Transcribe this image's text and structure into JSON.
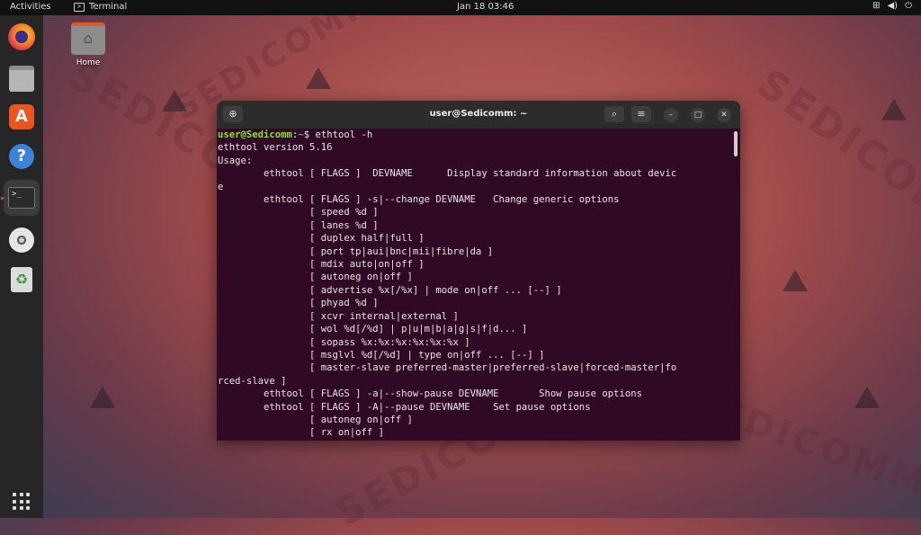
{
  "topbar": {
    "activities": "Activities",
    "app_menu": "Terminal",
    "clock": "Jan 18  03:46",
    "tray_icons": [
      "network-icon",
      "volume-icon",
      "power-icon"
    ]
  },
  "desktop": {
    "home_label": "Home",
    "watermark": "SEDICOMM"
  },
  "dock": {
    "items": [
      "firefox-icon",
      "files-icon",
      "software-icon",
      "help-icon",
      "terminal-icon",
      "disc-icon",
      "trash-icon"
    ],
    "active": "terminal-icon",
    "show_apps": "show-apps-icon"
  },
  "terminal": {
    "title": "user@Sedicomm: ~",
    "prompt_user": "user@Sedicomm",
    "prompt_sep": ":",
    "prompt_path": "~",
    "prompt_symbol": "$ ",
    "command": "ethtool -h",
    "output": [
      "ethtool version 5.16",
      "Usage:",
      "        ethtool [ FLAGS ]  DEVNAME      Display standard information about devic",
      "e",
      "        ethtool [ FLAGS ] -s|--change DEVNAME   Change generic options",
      "                [ speed %d ]",
      "                [ lanes %d ]",
      "                [ duplex half|full ]",
      "                [ port tp|aui|bnc|mii|fibre|da ]",
      "                [ mdix auto|on|off ]",
      "                [ autoneg on|off ]",
      "                [ advertise %x[/%x] | mode on|off ... [--] ]",
      "                [ phyad %d ]",
      "                [ xcvr internal|external ]",
      "                [ wol %d[/%d] | p|u|m|b|a|g|s|f|d... ]",
      "                [ sopass %x:%x:%x:%x:%x:%x ]",
      "                [ msglvl %d[/%d] | type on|off ... [--] ]",
      "                [ master-slave preferred-master|preferred-slave|forced-master|fo",
      "rced-slave ]",
      "        ethtool [ FLAGS ] -a|--show-pause DEVNAME       Show pause options",
      "        ethtool [ FLAGS ] -A|--pause DEVNAME    Set pause options",
      "                [ autoneg on|off ]",
      "                [ rx on|off ]"
    ]
  },
  "colors": {
    "terminal_bg": "#300a24",
    "prompt_user": "#8ae234",
    "prompt_path": "#729fcf",
    "accent": "#e95420"
  }
}
